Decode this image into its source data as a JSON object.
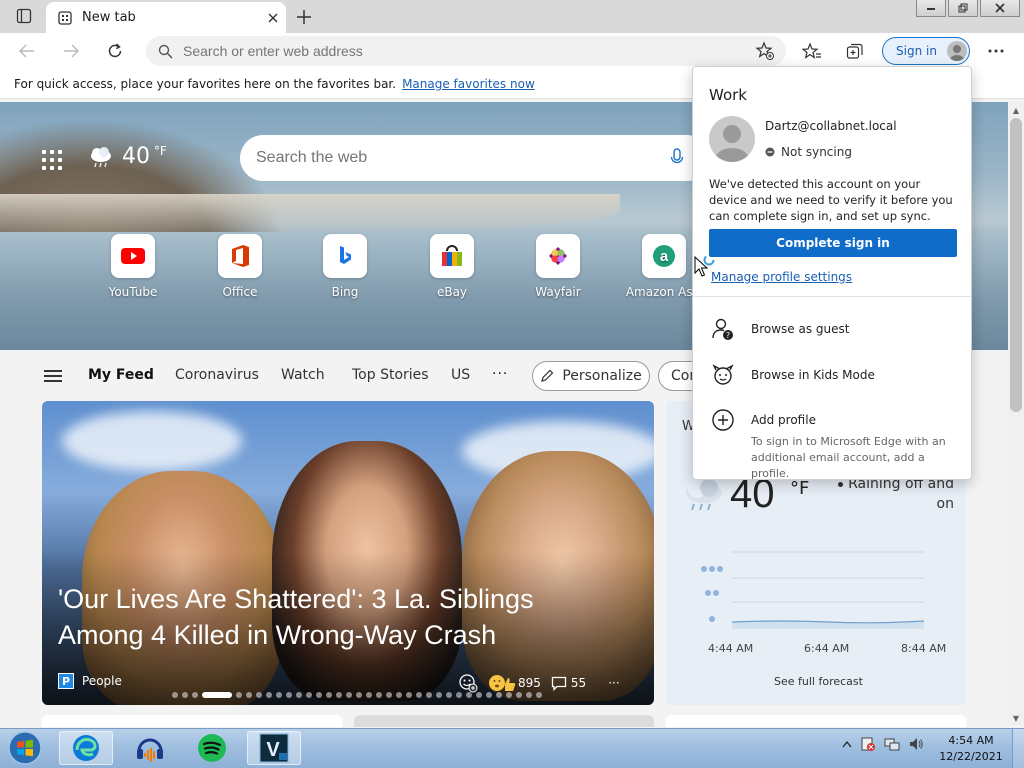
{
  "browser": {
    "tab": {
      "title": "New tab"
    },
    "address": {
      "placeholder": "Search or enter web address"
    },
    "signin_label": "Sign in"
  },
  "favorites_bar": {
    "message": "For quick access, place your favorites here on the favorites bar.",
    "link": "Manage favorites now"
  },
  "hero": {
    "temperature": "40",
    "unit": "°F",
    "search_placeholder": "Search the web",
    "quick_links": [
      {
        "label": "YouTube",
        "icon": "youtube-icon"
      },
      {
        "label": "Office",
        "icon": "office-icon"
      },
      {
        "label": "Bing",
        "icon": "bing-icon"
      },
      {
        "label": "eBay",
        "icon": "ebay-icon"
      },
      {
        "label": "Wayfair",
        "icon": "wayfair-icon"
      },
      {
        "label": "Amazon Assi",
        "icon": "amazon-icon"
      }
    ]
  },
  "feed": {
    "tabs": [
      "My Feed",
      "Coronavirus",
      "Watch",
      "Top Stories",
      "US"
    ],
    "more": "···",
    "personalize": "Personalize",
    "content_partial": "Cor"
  },
  "news": {
    "headline": "'Our Lives Are Shattered': 3 La. Siblings Among 4 Killed in Wrong-Way Crash",
    "source": "People",
    "source_logo": "P",
    "reactions": "895",
    "comments": "55",
    "more": "···"
  },
  "weather_card": {
    "initial": "W",
    "temperature": "40",
    "unit": "°F",
    "condition": "Raining off and on",
    "times": [
      "4:44 AM",
      "6:44 AM",
      "8:44 AM"
    ],
    "precipitation_levels": [
      3,
      2,
      1
    ],
    "see_full": "See full forecast"
  },
  "profile_flyout": {
    "title": "Work",
    "email": "Dartz@collabnet.local",
    "sync_status": "Not syncing",
    "message": "We've detected this account on your device and we need to verify it before you can complete sign in, and set up sync.",
    "complete_button": "Complete sign in",
    "manage_link": "Manage profile settings",
    "browse_guest": "Browse as guest",
    "browse_kids": "Browse in Kids Mode",
    "add_profile": "Add profile",
    "add_profile_desc": "To sign in to Microsoft Edge with an additional email account, add a profile."
  },
  "taskbar": {
    "time": "4:54 AM",
    "date": "12/22/2021",
    "apps": [
      "edge-icon",
      "audacity-icon",
      "spotify-icon",
      "veracrypt-icon"
    ]
  },
  "colors": {
    "accent": "#0f6cc9",
    "link": "#1a5fb4",
    "taskbar": "#9fbfe0"
  }
}
